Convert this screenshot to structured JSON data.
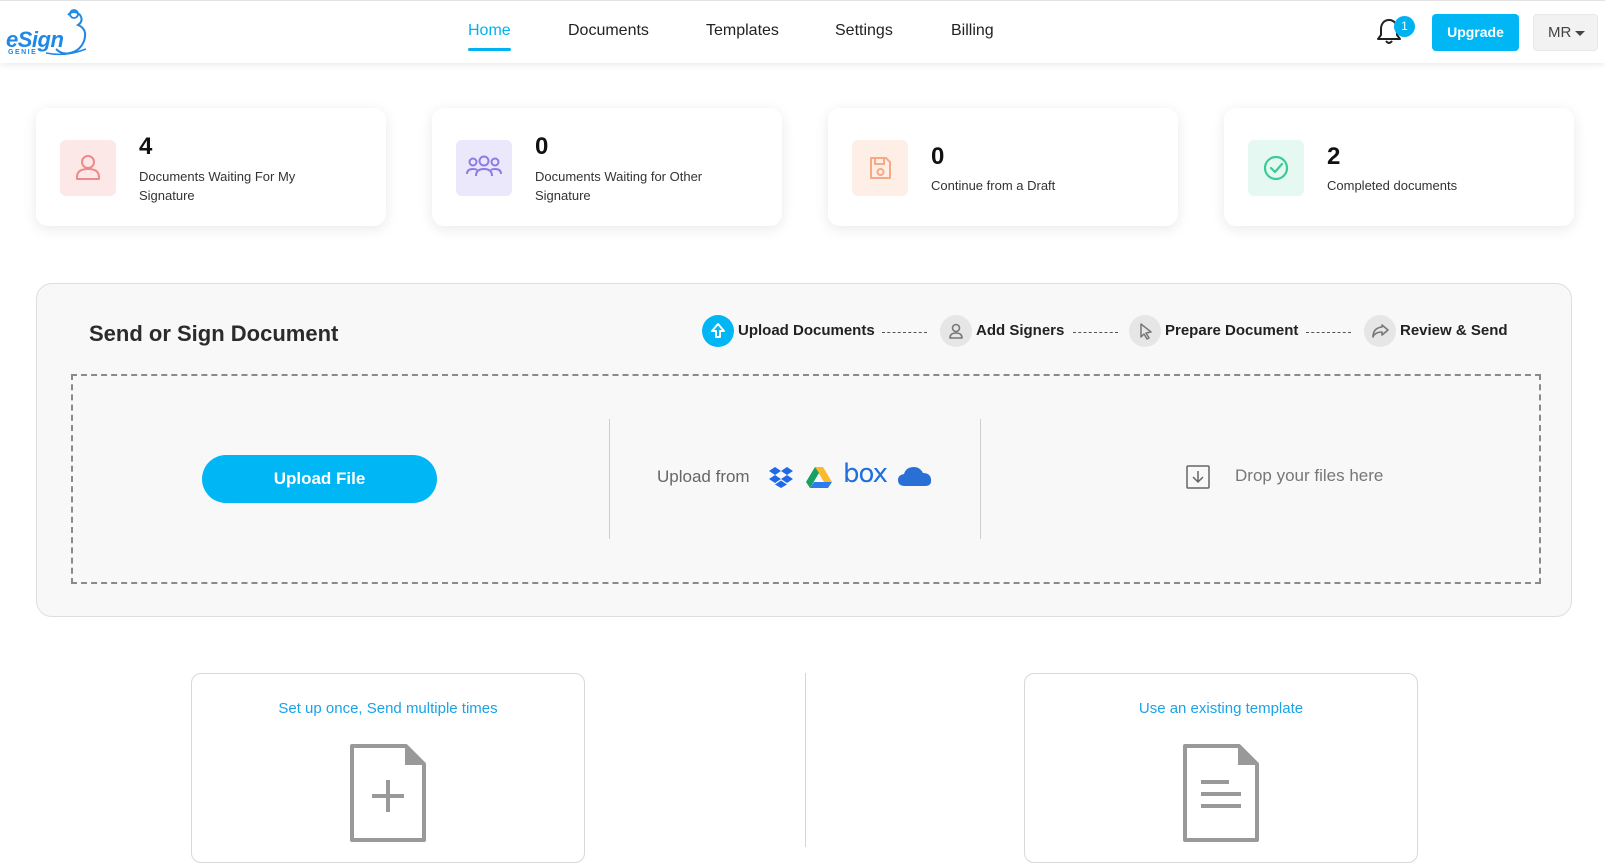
{
  "header": {
    "logo_text": "eSign",
    "logo_sub": "GENIE",
    "nav": [
      {
        "label": "Home",
        "active": true
      },
      {
        "label": "Documents",
        "active": false
      },
      {
        "label": "Templates",
        "active": false
      },
      {
        "label": "Settings",
        "active": false
      },
      {
        "label": "Billing",
        "active": false
      }
    ],
    "notification_count": "1",
    "upgrade_label": "Upgrade",
    "user_initials": "MR"
  },
  "stats": [
    {
      "count": "4",
      "label": "Documents Waiting For My Signature",
      "icon": "user-icon",
      "icon_bg": "#fde8e8",
      "icon_color": "#f08a8a"
    },
    {
      "count": "0",
      "label": "Documents Waiting for Other Signature",
      "icon": "users-icon",
      "icon_bg": "#ebe8fb",
      "icon_color": "#8b7be6"
    },
    {
      "count": "0",
      "label": "Continue from a Draft",
      "icon": "save-icon",
      "icon_bg": "#fdeee6",
      "icon_color": "#f6a984"
    },
    {
      "count": "2",
      "label": "Completed documents",
      "icon": "check-circle-icon",
      "icon_bg": "#e5f8f1",
      "icon_color": "#3ccb95"
    }
  ],
  "send_panel": {
    "title": "Send or Sign Document",
    "steps": [
      {
        "label": "Upload Documents",
        "icon": "upload-arrow-icon",
        "active": true
      },
      {
        "label": "Add Signers",
        "icon": "user-icon",
        "active": false
      },
      {
        "label": "Prepare Document",
        "icon": "cursor-icon",
        "active": false
      },
      {
        "label": "Review & Send",
        "icon": "share-icon",
        "active": false
      }
    ],
    "upload_button": "Upload File",
    "upload_from_label": "Upload from",
    "providers": [
      "dropbox-icon",
      "google-drive-icon",
      "box-icon",
      "onedrive-icon"
    ],
    "box_text": "box",
    "drop_text": "Drop your files here"
  },
  "bottom": {
    "left_title": "Set up once, Send multiple times",
    "right_title": "Use an existing template"
  },
  "colors": {
    "accent": "#00b6f5",
    "link": "#1aa3e8"
  }
}
